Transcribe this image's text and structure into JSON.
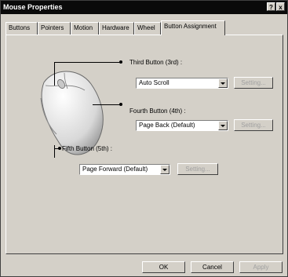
{
  "window": {
    "title": "Mouse Properties",
    "help_glyph": "?",
    "close_glyph": "x"
  },
  "tabs": [
    {
      "label": "Buttons"
    },
    {
      "label": "Pointers"
    },
    {
      "label": "Motion"
    },
    {
      "label": "Hardware"
    },
    {
      "label": "Wheel"
    },
    {
      "label": "Button Assignment",
      "active": true
    }
  ],
  "third_button": {
    "label": "Third Button (3rd) :",
    "value": "Auto Scroll",
    "setting_label": "Setting..."
  },
  "fourth_button": {
    "label": "Fourth Button (4th) :",
    "value": "Page Back (Default)",
    "setting_label": "Setting..."
  },
  "fifth_button": {
    "label": "Fifth Button (5th) :",
    "value": "Page Forward (Default)",
    "setting_label": "Setting..."
  },
  "footer": {
    "ok_label": "OK",
    "cancel_label": "Cancel",
    "apply_label": "Apply"
  }
}
